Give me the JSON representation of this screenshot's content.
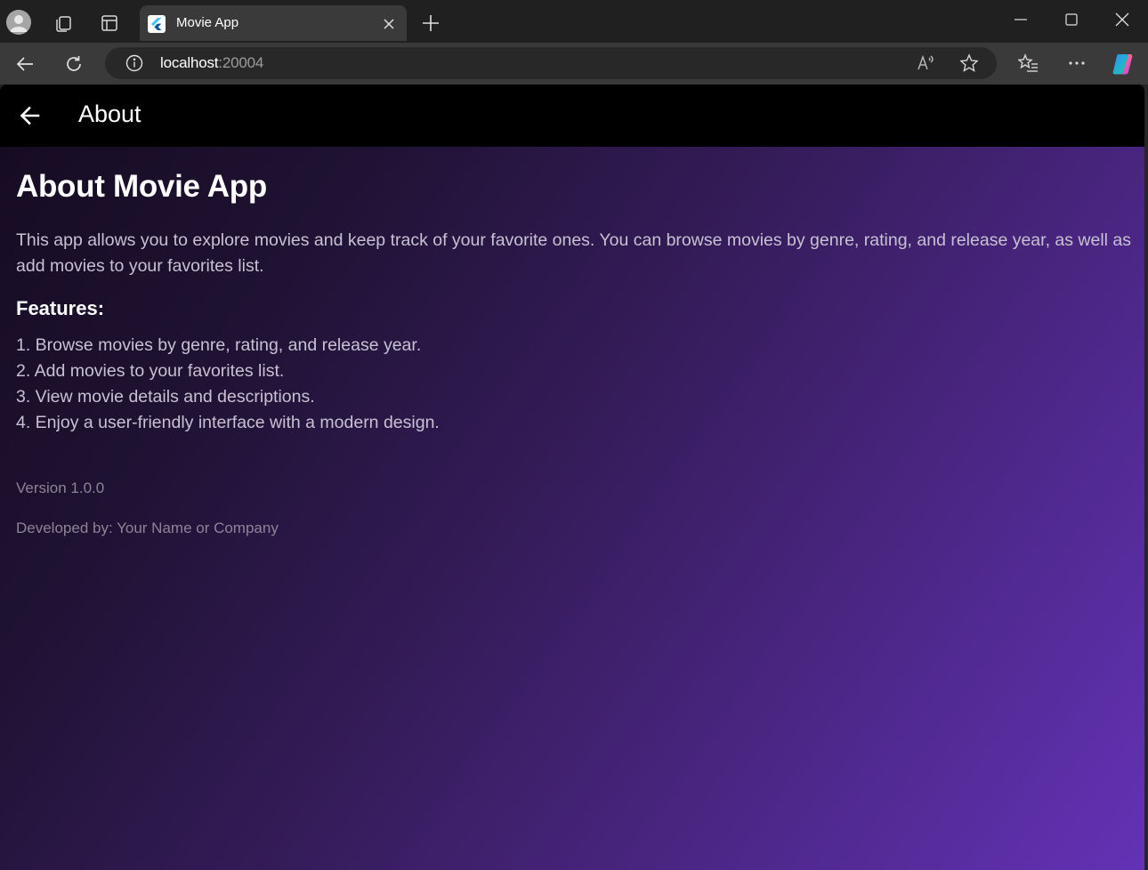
{
  "browser": {
    "tab_title": "Movie App",
    "url_host": "localhost",
    "url_port": ":20004"
  },
  "app": {
    "appbar_title": "About",
    "heading": "About Movie App",
    "description": "This app allows you to explore movies and keep track of your favorite ones. You can browse movies by genre, rating, and release year, as well as add movies to your favorites list.",
    "features_title": "Features:",
    "features": [
      "1. Browse movies by genre, rating, and release year.",
      "2. Add movies to your favorites list.",
      "3. View movie details and descriptions.",
      "4. Enjoy a user-friendly interface with a modern design."
    ],
    "version": "Version 1.0.0",
    "developer": "Developed by: Your Name or Company"
  },
  "icons": {
    "profile": "profile-avatar-icon",
    "workspaces": "workspaces-icon",
    "tab_actions": "tab-actions-icon",
    "favicon": "flutter-favicon-icon",
    "tab_close": "close-icon",
    "new_tab": "plus-icon",
    "minimize": "minimize-icon",
    "maximize": "maximize-icon",
    "window_close": "close-icon",
    "back": "arrow-left-icon",
    "reload": "reload-icon",
    "site_info": "info-icon",
    "read_aloud": "read-aloud-icon",
    "favorite": "star-icon",
    "favorites": "favorites-list-icon",
    "more": "more-icon",
    "copilot": "copilot-icon",
    "appbar_back": "arrow-left-icon"
  },
  "colors": {
    "gradient_start": "#160c22",
    "gradient_end": "#6332b6",
    "appbar_bg": "#000000",
    "text_primary": "#ffffff",
    "text_body": "#c7c1d3",
    "text_muted": "#8c8497"
  }
}
